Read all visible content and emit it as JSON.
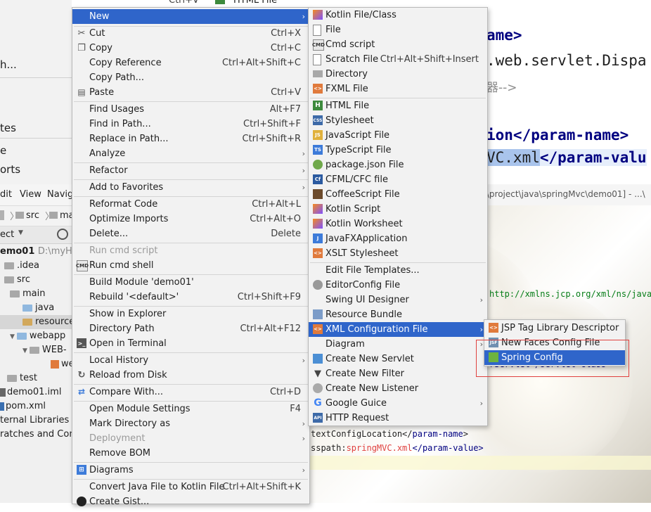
{
  "background": {
    "left_fragments": [
      "h...",
      "tes",
      "e",
      "orts"
    ],
    "editor_top": {
      "line1": "ame>",
      "line2": ".web.servlet.Dispa",
      "line3": "器-->",
      "line4_text": "ion</param-name>",
      "line5_value": "VC.xml",
      "line5_rest": "</param-valu",
      "partial_top_shortcut": "Ctrl+V",
      "partial_top_item": "HTML File"
    },
    "ide_menubar": [
      "dit",
      "View",
      "Navig"
    ],
    "breadcrumb": [
      "src",
      "ma"
    ],
    "path_bar": "rk\\project\\java\\springMvc\\demo01] - ...\\",
    "project_header": "ect",
    "tree": [
      {
        "label": "emo01",
        "extra": "D:\\myHon"
      },
      {
        "label": ".idea"
      },
      {
        "label": "src"
      },
      {
        "label": "main"
      },
      {
        "label": "java"
      },
      {
        "label": "resource"
      },
      {
        "label": "webapp"
      },
      {
        "label": "WEB-"
      },
      {
        "label": "we"
      },
      {
        "label": "test"
      },
      {
        "label": "demo01.iml"
      },
      {
        "label": "pom.xml"
      },
      {
        "label": "ternal Libraries"
      },
      {
        "label": "ratches and Cons"
      }
    ],
    "editor_lines": {
      "xmlns": "http://xmlns.jcp.org/xml/ns/javae",
      "servlet_class": "rServlet</servlet-class>",
      "cfg_name_pre": "textConfigLocation</",
      "cfg_name_tag": "param-name",
      "cfg_name_post": ">",
      "cfg_val_pre": "sspath:",
      "cfg_val_value": "springMVC.xml",
      "cfg_val_post": "</param-value>"
    }
  },
  "context_menu": {
    "items": [
      {
        "label": "New",
        "submenu": true,
        "selected": true
      },
      {
        "label": "Cut",
        "shortcut": "Ctrl+X",
        "icon": "scissors-icon"
      },
      {
        "label": "Copy",
        "shortcut": "Ctrl+C",
        "icon": "copy-icon"
      },
      {
        "label": "Copy Reference",
        "shortcut": "Ctrl+Alt+Shift+C"
      },
      {
        "label": "Copy Path...",
        "shortcut": ""
      },
      {
        "label": "Paste",
        "shortcut": "Ctrl+V",
        "icon": "clipboard-icon"
      },
      {
        "label": "Find Usages",
        "shortcut": "Alt+F7"
      },
      {
        "label": "Find in Path...",
        "shortcut": "Ctrl+Shift+F"
      },
      {
        "label": "Replace in Path...",
        "shortcut": "Ctrl+Shift+R"
      },
      {
        "label": "Analyze",
        "submenu": true
      },
      {
        "label": "Refactor",
        "submenu": true
      },
      {
        "label": "Add to Favorites",
        "submenu": true
      },
      {
        "label": "Reformat Code",
        "shortcut": "Ctrl+Alt+L"
      },
      {
        "label": "Optimize Imports",
        "shortcut": "Ctrl+Alt+O"
      },
      {
        "label": "Delete...",
        "shortcut": "Delete"
      },
      {
        "label": "Run cmd script",
        "disabled": true
      },
      {
        "label": "Run cmd shell",
        "icon": "cmd-icon"
      },
      {
        "label": "Build Module 'demo01'"
      },
      {
        "label": "Rebuild '<default>'",
        "shortcut": "Ctrl+Shift+F9"
      },
      {
        "label": "Show in Explorer"
      },
      {
        "label": "Directory Path",
        "shortcut": "Ctrl+Alt+F12"
      },
      {
        "label": "Open in Terminal",
        "icon": "terminal-icon"
      },
      {
        "label": "Local History",
        "submenu": true
      },
      {
        "label": "Reload from Disk",
        "icon": "reload-icon"
      },
      {
        "label": "Compare With...",
        "shortcut": "Ctrl+D",
        "icon": "compare-icon"
      },
      {
        "label": "Open Module Settings",
        "shortcut": "F4"
      },
      {
        "label": "Mark Directory as",
        "submenu": true
      },
      {
        "label": "Deployment",
        "submenu": true,
        "disabled": true
      },
      {
        "label": "Remove BOM"
      },
      {
        "label": "Diagrams",
        "submenu": true,
        "icon": "diagrams-icon"
      },
      {
        "label": "Convert Java File to Kotlin File",
        "shortcut": "Ctrl+Alt+Shift+K"
      },
      {
        "label": "Create Gist...",
        "icon": "github-icon"
      }
    ]
  },
  "new_submenu": {
    "items": [
      {
        "label": "Kotlin File/Class",
        "icon": "kotlin-icon"
      },
      {
        "label": "File",
        "icon": "file-icon"
      },
      {
        "label": "Cmd script",
        "icon": "cmd-icon"
      },
      {
        "label": "Scratch File",
        "shortcut": "Ctrl+Alt+Shift+Insert",
        "icon": "scratch-icon"
      },
      {
        "label": "Directory",
        "icon": "folder-icon"
      },
      {
        "label": "FXML File",
        "icon": "fxml-icon"
      },
      {
        "label": "HTML File",
        "icon": "html-icon"
      },
      {
        "label": "Stylesheet",
        "icon": "css-icon"
      },
      {
        "label": "JavaScript File",
        "icon": "js-icon"
      },
      {
        "label": "TypeScript File",
        "icon": "ts-icon"
      },
      {
        "label": "package.json File",
        "icon": "nodejs-icon"
      },
      {
        "label": "CFML/CFC file",
        "icon": "cf-icon"
      },
      {
        "label": "CoffeeScript File",
        "icon": "coffee-icon"
      },
      {
        "label": "Kotlin Script",
        "icon": "kotlin-icon"
      },
      {
        "label": "Kotlin Worksheet",
        "icon": "kotlin-icon"
      },
      {
        "label": "JavaFXApplication",
        "icon": "javafx-icon"
      },
      {
        "label": "XSLT Stylesheet",
        "icon": "xslt-icon"
      },
      {
        "label": "Edit File Templates..."
      },
      {
        "label": "EditorConfig File",
        "icon": "editorconfig-icon"
      },
      {
        "label": "Swing UI Designer",
        "submenu": true
      },
      {
        "label": "Resource Bundle",
        "icon": "resource-bundle-icon"
      },
      {
        "label": "XML Configuration File",
        "submenu": true,
        "selected": true,
        "icon": "xml-icon"
      },
      {
        "label": "Diagram",
        "submenu": true
      },
      {
        "label": "Create New Servlet",
        "icon": "servlet-icon"
      },
      {
        "label": "Create New Filter",
        "icon": "filter-icon"
      },
      {
        "label": "Create New Listener",
        "icon": "listener-icon"
      },
      {
        "label": "Google Guice",
        "submenu": true,
        "icon": "google-icon"
      },
      {
        "label": "HTTP Request",
        "icon": "api-icon"
      }
    ]
  },
  "xml_submenu": {
    "items": [
      {
        "label": "JSP Tag Library Descriptor",
        "icon": "jsp-tag-icon"
      },
      {
        "label": "New Faces Config File",
        "icon": "jsf-icon"
      },
      {
        "label": "Spring Config",
        "selected": true,
        "icon": "spring-icon"
      }
    ]
  },
  "colors": {
    "selection": "#2f65ca",
    "highlight_box": "#e0413f",
    "menu_bg": "#f2f2f2",
    "xml_tag": "#000080",
    "xml_value": "#e0413f"
  }
}
